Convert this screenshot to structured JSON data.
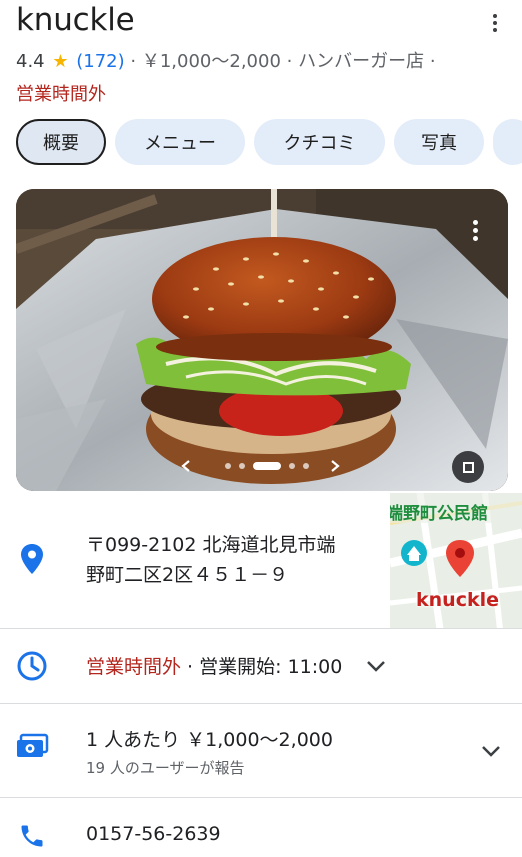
{
  "place": {
    "name": "knuckle",
    "rating": "4.4",
    "reviews": "(172)",
    "price_range": "￥1,000～2,000",
    "category": "ハンバーガー店",
    "status": "営業時間外"
  },
  "tabs": [
    {
      "label": "概要",
      "active": true
    },
    {
      "label": "メニュー",
      "active": false
    },
    {
      "label": "クチコミ",
      "active": false
    },
    {
      "label": "写真",
      "active": false
    }
  ],
  "carousel": {
    "total_dots": 5,
    "active_dot": 3
  },
  "address": {
    "line1": "〒099-2102 北海道北見市端",
    "line2": "野町二区2区４５１－９"
  },
  "map": {
    "poi_label": "端野町公民館",
    "pin_label": "knuckle"
  },
  "hours": {
    "status": "営業時間外",
    "separator": " · ",
    "open_text": "営業開始: 11:00"
  },
  "price": {
    "main": "1 人あたり ￥1,000～2,000",
    "sub": "19 人のユーザーが報告"
  },
  "phone": {
    "number": "0157-56-2639"
  },
  "colors": {
    "accent": "#1a73e8",
    "closed": "#b3261e",
    "star": "#f7b500"
  },
  "icons": [
    "more-vert-icon",
    "star-icon",
    "location-pin-icon",
    "clock-icon",
    "money-icon",
    "phone-icon",
    "chevron-down-icon",
    "chevron-left-icon",
    "chevron-right-icon",
    "expand-icon"
  ]
}
